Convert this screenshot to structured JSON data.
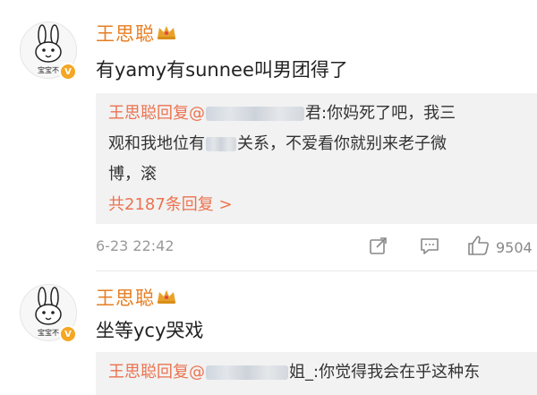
{
  "colors": {
    "username": "#e67e22",
    "reply_bg": "#f2f2f2",
    "link": "#eb7350"
  },
  "comments": [
    {
      "username": "王思聪",
      "text": "有yamy有sunnee叫男团得了",
      "reply": {
        "prefix": "王思聪回复@",
        "suffix_after_blur": "君:你妈死了吧，我三",
        "line2_a": "观和我地位有",
        "line2_b": "关系，不爱看你就别来老子微",
        "line3": "博，滚"
      },
      "more_replies": "共2187条回复 >",
      "timestamp": "6-23 22:42",
      "like_count": "9504",
      "icons": [
        "share-icon",
        "comment-icon",
        "like-icon"
      ]
    },
    {
      "username": "王思聪",
      "text": "坐等ycy哭戏",
      "reply": {
        "prefix": "王思聪回复@",
        "suffix_after_blur": "姐_:你觉得我会在乎这种东"
      }
    }
  ]
}
